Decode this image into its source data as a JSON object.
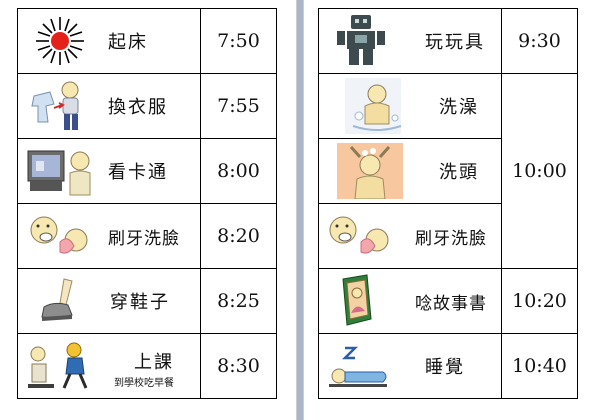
{
  "left_page": {
    "rows": [
      {
        "activity": "起床",
        "time": "7:50",
        "icon": "sun-icon"
      },
      {
        "activity": "換衣服",
        "time": "7:55",
        "icon": "dressing-child-icon"
      },
      {
        "activity": "看卡通",
        "time": "8:00",
        "icon": "tv-watching-icon"
      },
      {
        "activity": "刷牙洗臉",
        "time": "8:20",
        "icon": "brushing-teeth-icon"
      },
      {
        "activity": "穿鞋子",
        "time": "8:25",
        "icon": "shoe-icon"
      },
      {
        "activity": "上課",
        "subtext": "到學校吃早餐",
        "time": "8:30",
        "icon": "walk-to-school-icon"
      }
    ]
  },
  "right_page": {
    "rows": [
      {
        "activity": "玩玩具",
        "time": "9:30",
        "icon": "robot-toy-icon"
      },
      {
        "activity": "洗澡",
        "icon": "bath-icon"
      },
      {
        "activity": "洗頭",
        "icon": "wash-hair-icon"
      },
      {
        "activity": "刷牙洗臉",
        "icon": "brushing-teeth-icon"
      },
      {
        "activity": "唸故事書",
        "time": "10:20",
        "icon": "storybook-icon"
      },
      {
        "activity": "睡覺",
        "time": "10:40",
        "icon": "sleeping-icon"
      }
    ],
    "merged_time": "10:00"
  },
  "colors": {
    "background": "#a9b7c8",
    "sun": "#e5221a",
    "robot": "#3d4b4f",
    "book": "#2f7f3a"
  }
}
